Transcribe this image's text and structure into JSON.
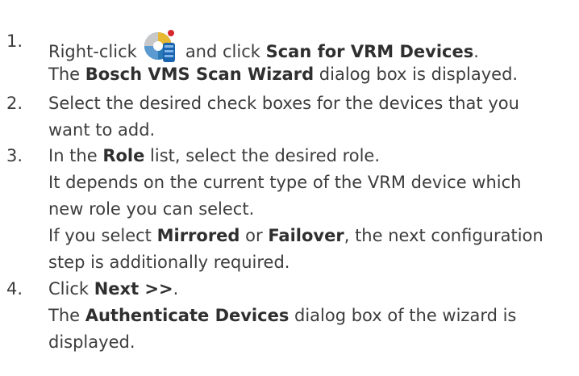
{
  "steps": [
    {
      "number": "1.",
      "lines": [
        {
          "pre": "Right-click",
          "icon": "vrm-device-icon",
          "mid": "and click ",
          "bold": "Scan for VRM Devices",
          "post": "."
        },
        {
          "pre": "The ",
          "bold": "Bosch VMS Scan Wizard",
          "post": " dialog box is displayed."
        }
      ]
    },
    {
      "number": "2.",
      "lines": [
        {
          "text": "Select the desired check boxes for the devices that you"
        },
        {
          "text": "want to add."
        }
      ]
    },
    {
      "number": "3.",
      "lines": [
        {
          "pre": "In the ",
          "bold": "Role",
          "post": " list, select the desired role."
        },
        {
          "text": "It depends on the current type of the VRM device which"
        },
        {
          "text": "new role you can select."
        },
        {
          "pre": "If you select ",
          "bold": "Mirrored",
          "mid": " or ",
          "bold2": "Failover",
          "post": ", the next configuration"
        },
        {
          "text": "step is additionally required."
        }
      ]
    },
    {
      "number": "4.",
      "lines": [
        {
          "pre": "Click ",
          "bold": "Next >>",
          "post": "."
        },
        {
          "pre": "The ",
          "bold": "Authenticate Devices",
          "post": " dialog box of the wizard is"
        },
        {
          "text": "displayed."
        }
      ]
    }
  ]
}
